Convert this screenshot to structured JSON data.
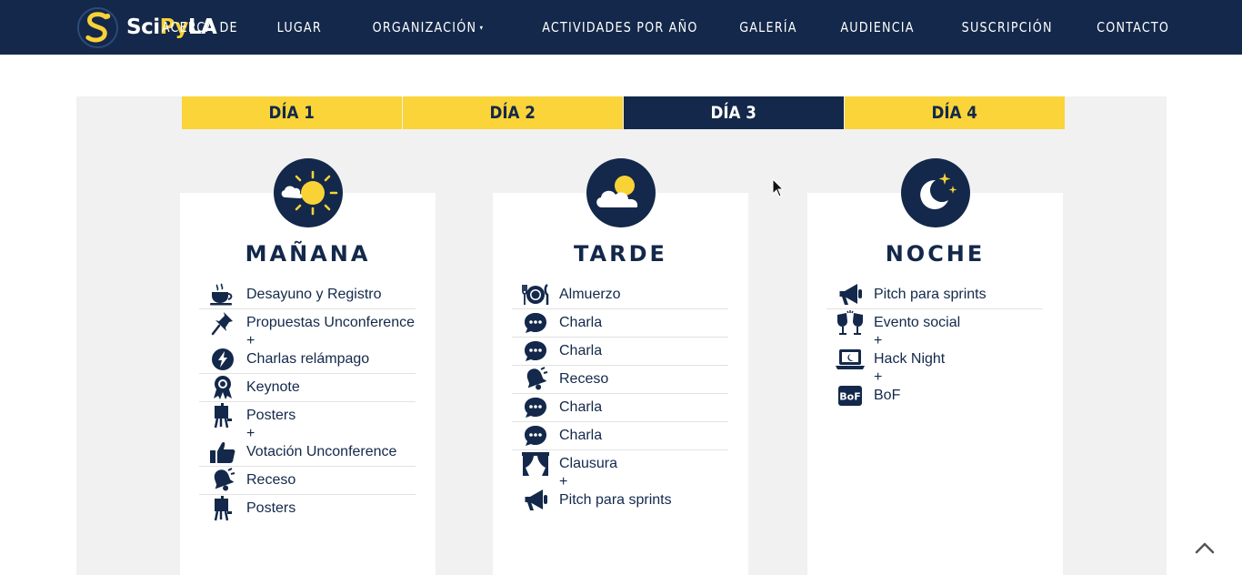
{
  "brand": {
    "part1": "Sci",
    "part2": "Py",
    "part3": "LA"
  },
  "nav": [
    {
      "label": "ACERCA DE"
    },
    {
      "label": "LUGAR"
    },
    {
      "label": "ORGANIZACIÓN",
      "caret": "▾"
    },
    {
      "label": "ACTIVIDADES POR AÑO"
    },
    {
      "label": "GALERÍA"
    },
    {
      "label": "AUDIENCIA"
    },
    {
      "label": "SUSCRIPCIÓN"
    },
    {
      "label": "CONTACTO"
    }
  ],
  "tabs": [
    {
      "label": "DÍA 1",
      "active": false
    },
    {
      "label": "DÍA 2",
      "active": false
    },
    {
      "label": "DÍA 3",
      "active": true
    },
    {
      "label": "DÍA 4",
      "active": false
    }
  ],
  "plus_sign": "+",
  "columns": [
    {
      "title": "MAÑANA",
      "icon": "sun-cloud-icon",
      "items": [
        {
          "parts": [
            {
              "icon": "coffee-icon",
              "label": "Desayuno y Registro"
            }
          ]
        },
        {
          "parts": [
            {
              "icon": "pushpin-icon",
              "label": "Propuestas Unconference"
            },
            {
              "icon": "lightning-icon",
              "label": "Charlas relámpago"
            }
          ]
        },
        {
          "parts": [
            {
              "icon": "award-icon",
              "label": "Keynote"
            }
          ]
        },
        {
          "parts": [
            {
              "icon": "easel-icon",
              "label": "Posters"
            },
            {
              "icon": "thumbs-up-icon",
              "label": "Votación Unconference"
            }
          ]
        },
        {
          "parts": [
            {
              "icon": "bell-icon",
              "label": "Receso"
            }
          ]
        },
        {
          "parts": [
            {
              "icon": "easel-icon",
              "label": "Posters"
            }
          ]
        }
      ]
    },
    {
      "title": "TARDE",
      "icon": "cloud-sun-icon",
      "items": [
        {
          "parts": [
            {
              "icon": "utensils-icon",
              "label": "Almuerzo"
            }
          ]
        },
        {
          "parts": [
            {
              "icon": "chat-icon",
              "label": "Charla"
            }
          ]
        },
        {
          "parts": [
            {
              "icon": "chat-icon",
              "label": "Charla"
            }
          ]
        },
        {
          "parts": [
            {
              "icon": "bell-icon",
              "label": "Receso"
            }
          ]
        },
        {
          "parts": [
            {
              "icon": "chat-icon",
              "label": "Charla"
            }
          ]
        },
        {
          "parts": [
            {
              "icon": "chat-icon",
              "label": "Charla"
            }
          ]
        },
        {
          "parts": [
            {
              "icon": "curtains-icon",
              "label": "Clausura"
            },
            {
              "icon": "megaphone-icon",
              "label": "Pitch para sprints"
            }
          ]
        }
      ]
    },
    {
      "title": "NOCHE",
      "icon": "moon-stars-icon",
      "items": [
        {
          "parts": [
            {
              "icon": "megaphone-icon",
              "label": "Pitch para sprints"
            }
          ]
        },
        {
          "parts": [
            {
              "icon": "glasses-toast-icon",
              "label": "Evento social"
            },
            {
              "icon": "laptop-icon",
              "label": "Hack Night"
            },
            {
              "icon": "bof-icon",
              "label": "BoF",
              "badge": "BoF"
            }
          ]
        }
      ]
    }
  ],
  "colors": {
    "navy": "#13284a",
    "yellow": "#fad438",
    "panel": "#f1f1f1"
  }
}
